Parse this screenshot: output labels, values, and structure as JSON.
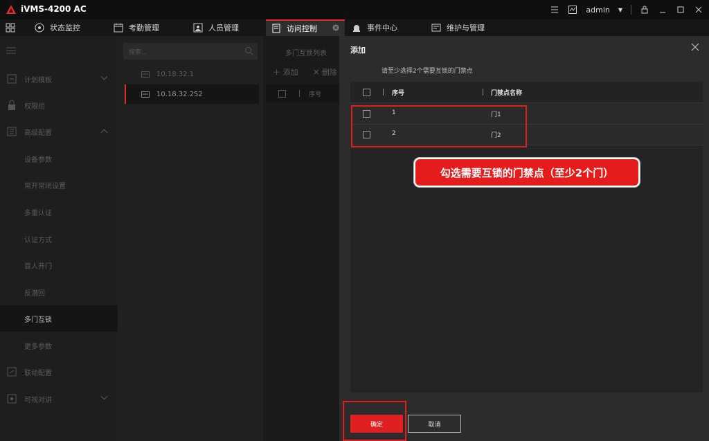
{
  "app": {
    "title": "iVMS-4200 AC",
    "user": "admin",
    "accent_color": "#e02b2b"
  },
  "tabs": [
    {
      "label": "状态监控",
      "icon": "status-monitor-icon"
    },
    {
      "label": "考勤管理",
      "icon": "calendar-icon"
    },
    {
      "label": "人员管理",
      "icon": "person-card-icon"
    },
    {
      "label": "访问控制",
      "icon": "door-access-icon",
      "active": true
    },
    {
      "label": "事件中心",
      "icon": "alarm-bell-icon"
    },
    {
      "label": "维护与管理",
      "icon": "maintenance-icon"
    }
  ],
  "sidebar": {
    "items": [
      {
        "label": "计划模板",
        "icon": "schedule-icon"
      },
      {
        "label": "权限组",
        "icon": "lock-icon"
      },
      {
        "label": "高级配置",
        "icon": "advanced-icon"
      },
      {
        "label": "设备参数"
      },
      {
        "label": "常开常闭设置"
      },
      {
        "label": "多重认证"
      },
      {
        "label": "认证方式"
      },
      {
        "label": "首人开门"
      },
      {
        "label": "反潜回"
      },
      {
        "label": "多门互锁",
        "selected": true
      },
      {
        "label": "更多参数"
      },
      {
        "label": "联动配置",
        "icon": "linkage-icon"
      },
      {
        "label": "可视对讲",
        "icon": "intercom-icon"
      }
    ]
  },
  "devices": {
    "search_placeholder": "搜索...",
    "items": [
      "10.18.32.1",
      "10.18.32.252"
    ]
  },
  "middle": {
    "list_title": "多门互锁列表",
    "add_label": "添加",
    "delete_label": "删除",
    "col_index": "序号"
  },
  "dialog": {
    "title": "添加",
    "hint": "请至少选择2个需要互锁的门禁点",
    "columns": {
      "index": "序号",
      "name": "门禁点名称"
    },
    "rows": [
      {
        "index": "1",
        "name": "门1"
      },
      {
        "index": "2",
        "name": "门2"
      }
    ],
    "ok_label": "确定",
    "cancel_label": "取消"
  },
  "annotation": {
    "callout_text": "勾选需要互锁的门禁点（至少2个门）"
  }
}
